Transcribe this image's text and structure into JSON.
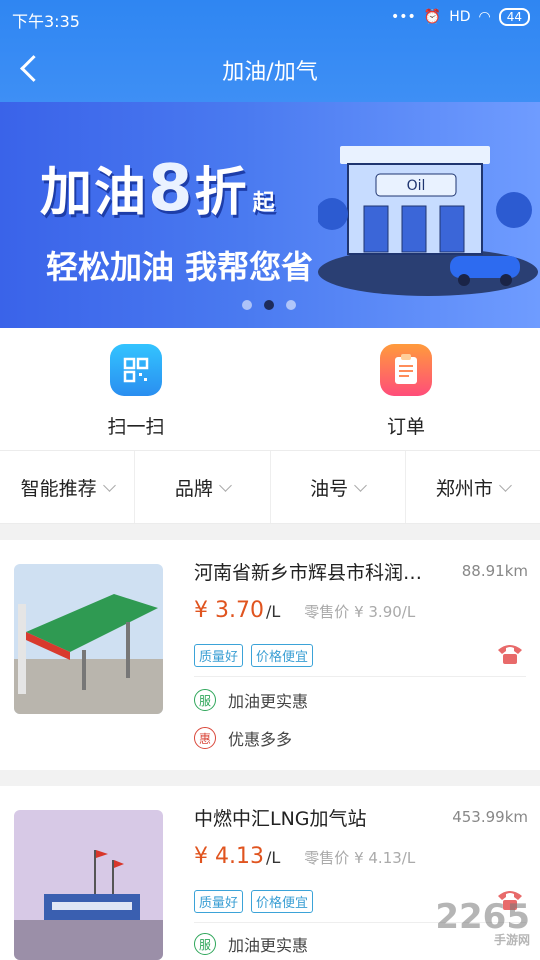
{
  "status": {
    "time": "下午3:35",
    "battery": "44",
    "signal": "HD"
  },
  "header": {
    "title": "加油/加气"
  },
  "banner": {
    "line1_a": "加油",
    "line1_num": "8",
    "line1_b": "折",
    "line1_suffix": "起",
    "line2": "轻松加油  我帮您省",
    "sign": "Oil",
    "page_count": 3,
    "active_page": 2
  },
  "actions": [
    {
      "label": "扫一扫",
      "icon": "qr-scan-icon"
    },
    {
      "label": "订单",
      "icon": "order-clipboard-icon"
    }
  ],
  "filters": [
    {
      "label": "智能推荐"
    },
    {
      "label": "品牌"
    },
    {
      "label": "油号"
    },
    {
      "label": "郑州市"
    }
  ],
  "stations": [
    {
      "name": "河南省新乡市辉县市科润…",
      "distance": "88.91km",
      "price": "¥ 3.70",
      "unit": "/L",
      "retail": "零售价 ¥ 3.90/L",
      "tags": [
        "质量好",
        "价格便宜"
      ],
      "promos": [
        {
          "badge": "服",
          "text": "加油更实惠"
        },
        {
          "badge": "惠",
          "text": "优惠多多"
        }
      ]
    },
    {
      "name": "中燃中汇LNG加气站",
      "distance": "453.99km",
      "price": "¥ 4.13",
      "unit": "/L",
      "retail": "零售价 ¥ 4.13/L",
      "tags": [
        "质量好",
        "价格便宜"
      ],
      "promos": [
        {
          "badge": "服",
          "text": "加油更实惠"
        }
      ]
    }
  ],
  "watermark": {
    "brand": "2265",
    "sub": "手游网"
  }
}
